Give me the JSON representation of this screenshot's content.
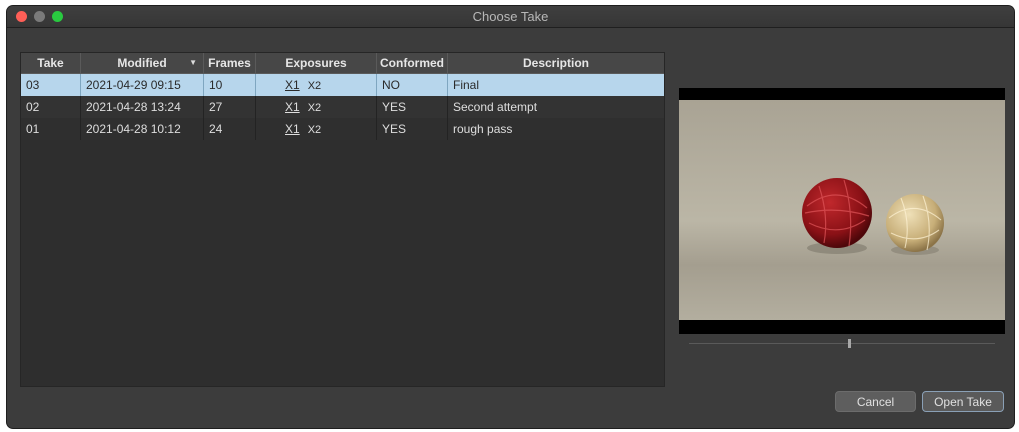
{
  "window": {
    "title": "Choose Take"
  },
  "table": {
    "columns": {
      "take": "Take",
      "modified": "Modified",
      "frames": "Frames",
      "exposures": "Exposures",
      "conformed": "Conformed",
      "description": "Description"
    },
    "sort_icon": "sort-descending-icon",
    "rows": [
      {
        "take": "03",
        "modified": "2021-04-29 09:15",
        "frames": "10",
        "x1": "X1",
        "x2": "X2",
        "conformed": "NO",
        "description": "Final",
        "selected": true
      },
      {
        "take": "02",
        "modified": "2021-04-28 13:24",
        "frames": "27",
        "x1": "X1",
        "x2": "X2",
        "conformed": "YES",
        "description": "Second attempt",
        "selected": false
      },
      {
        "take": "01",
        "modified": "2021-04-28 10:12",
        "frames": "24",
        "x1": "X1",
        "x2": "X2",
        "conformed": "YES",
        "description": "rough pass",
        "selected": false
      }
    ]
  },
  "preview": {
    "scrubber_position": 0.5
  },
  "buttons": {
    "cancel": "Cancel",
    "open": "Open Take"
  },
  "colors": {
    "selection": "#b7d6ec",
    "close": "#ff5f57",
    "maximize": "#29c940"
  }
}
